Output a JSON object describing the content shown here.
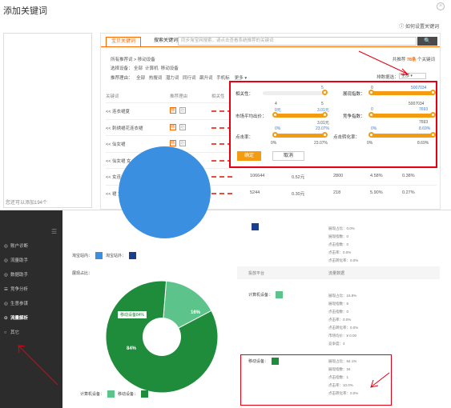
{
  "dialog": {
    "title": "添加关键词",
    "close": "×",
    "help": "如何设置关键词",
    "left_footer": "您还可以添加194个"
  },
  "tabs": {
    "active": "宝贝关键词",
    "other": "搜索关键词"
  },
  "search": {
    "placeholder": "同步淘宝网搜索，请点击查看系统推荐的关键词",
    "button": "🔍"
  },
  "trail": "所有推荐词 >  移动设备",
  "total": {
    "prefix": "共推荐",
    "count": "78条",
    "suffix": "个关键词"
  },
  "filters": [
    {
      "label": "选择设备：",
      "opts": [
        "全部",
        "计算机",
        "移动设备"
      ]
    },
    {
      "label": "推荐理由：",
      "opts": [
        "全部",
        "热搜词",
        "潜力词",
        "同行词",
        "飙升词",
        "手机标",
        "更多"
      ]
    }
  ],
  "sort": {
    "label": "排数据选：",
    "value": "全部"
  },
  "table_head": [
    "关键词",
    "推荐理由",
    "相关性"
  ],
  "rows": [
    {
      "kw": "<< 连衣裙夏",
      "v1": "",
      "v2": "",
      "v3": "",
      "v4": "",
      "v5": ""
    },
    {
      "kw": "<< 刺绣裙花连衣裙",
      "v1": "",
      "v2": "",
      "v3": "",
      "v4": "",
      "v5": ""
    },
    {
      "kw": "<< 仙女裙",
      "v1": "",
      "v2": "",
      "v3": "",
      "v4": "",
      "v5": ""
    },
    {
      "kw": "<< 仙女裙 女",
      "v1": "",
      "v2": "",
      "v3": "",
      "v4": "",
      "v5": ""
    },
    {
      "kw": "<< 女连衣裙",
      "v1": "106644",
      "v2": "0.52元",
      "v3": "2800",
      "v4": "4.58%",
      "v5": "0.38%"
    },
    {
      "kw": "<< 裙 女 夏",
      "v1": "5244",
      "v2": "0.30元",
      "v3": "218",
      "v4": "5.90%",
      "v5": "0.27%"
    }
  ],
  "popup": {
    "s1": {
      "label": "相关性：",
      "min": "",
      "max": "5",
      "fill": 1.0
    },
    "s2": {
      "label": "展现指数：",
      "min": "0",
      "max": "5007034",
      "cur": "5007034",
      "fill": 1.0
    },
    "s3": {
      "label": "市场平均出价：",
      "min": "0元",
      "max": "3.01元",
      "top": "4",
      "topmax": "5",
      "mid": "3.01元",
      "fill": 1.0
    },
    "s4": {
      "label": "竞争指数：",
      "min": "0",
      "max": "7693",
      "cur": "7693",
      "fill": 1.0
    },
    "s5": {
      "label": "点击率：",
      "min": "0%",
      "max": "23.07%",
      "cur": "23.07%",
      "fill": 1.0
    },
    "s6": {
      "label": "点击转化率：",
      "min": "0%",
      "max": "8.69%",
      "cur": "8.69%",
      "fill": 1.0
    },
    "ok": "确定",
    "cancel": "取消"
  },
  "sidebar": [
    {
      "label": "账户诊断",
      "icon": "◎"
    },
    {
      "label": "流量助手",
      "icon": "◎"
    },
    {
      "label": "数据助手",
      "icon": "◎"
    },
    {
      "label": "竞争分析",
      "icon": "☰"
    },
    {
      "label": "生意参谋",
      "icon": "◎"
    },
    {
      "label": "流量解析",
      "icon": "⊙",
      "active": true
    },
    {
      "label": "其它",
      "icon": "○"
    }
  ],
  "chart": {
    "legend_top": [
      {
        "label": "淘宝站内：",
        "color": "#3b8fe0"
      },
      {
        "label": "淘宝站外：",
        "color": "#1a3d8f"
      }
    ],
    "section": "展现占比：",
    "donut_label": "移动设备84%",
    "pct_small": "16%",
    "pct_big": "84%",
    "legend_bottom": [
      {
        "label": "计算机设备：",
        "color": "#5cc48a"
      },
      {
        "label": "移动设备：",
        "color": "#1e8c3a"
      }
    ],
    "chart_data": {
      "type": "pie",
      "categories": [
        "计算机设备",
        "移动设备"
      ],
      "values": [
        16,
        84
      ]
    }
  },
  "right": {
    "head1": "投放平台",
    "head2": "流量数据",
    "group1": {
      "label": "",
      "items": [
        "展现占比：0.0%",
        "展现指数：0",
        "点击指数：0",
        "点击率：0.0%",
        "点击转化率：0.0%"
      ]
    },
    "group2": {
      "label": "计算机设备：",
      "items": [
        "展现占比：15.9%",
        "展现指数：6",
        "点击指数：0",
        "点击率：0.0%",
        "点击转化率：0.0%",
        "市场均价：¥ 0.00",
        "竞争度：4"
      ]
    },
    "group3": {
      "label": "移动设备：",
      "items": [
        "展现占比：84.1%",
        "展现指数：34",
        "点击指数：1",
        "点击率：10.0%",
        "点击转化率：0.0%"
      ]
    }
  }
}
